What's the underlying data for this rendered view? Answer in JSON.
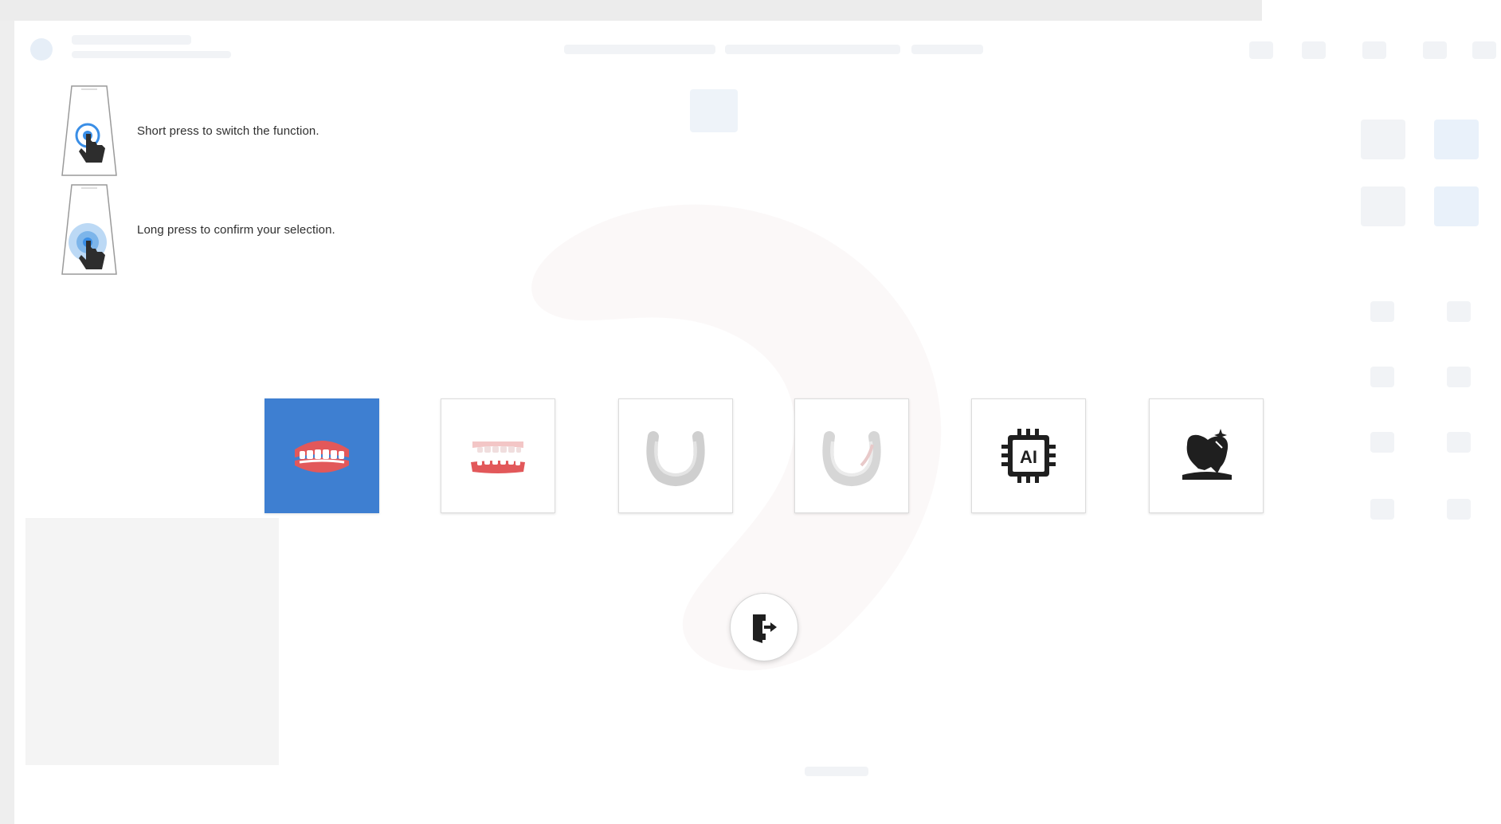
{
  "instructions": {
    "short_press": "Short press to switch the function.",
    "long_press": "Long press to confirm your selection."
  },
  "functions": [
    {
      "icon": "full-mouth-teeth-icon",
      "selected": true
    },
    {
      "icon": "upper-lower-teeth-icon",
      "selected": false
    },
    {
      "icon": "upper-jaw-icon",
      "selected": false
    },
    {
      "icon": "lower-jaw-icon",
      "selected": false
    },
    {
      "icon": "ai-chip-icon",
      "selected": false
    },
    {
      "icon": "tooth-clean-icon",
      "selected": false
    }
  ],
  "exit": {
    "icon": "exit-door-icon"
  },
  "colors": {
    "selected_tile": "#3e7fd1",
    "gum": "#e2585a",
    "scanner_touch": "#3a8ee6"
  }
}
